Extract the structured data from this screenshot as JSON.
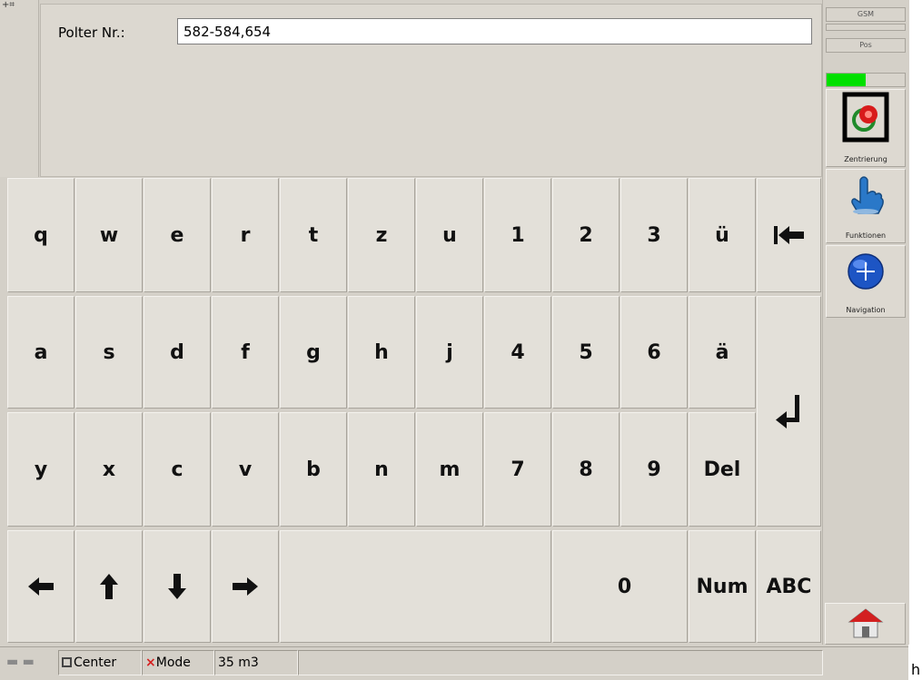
{
  "form": {
    "label": "Polter Nr.:",
    "value": "582-584,654"
  },
  "keyboard": {
    "row1": [
      "q",
      "w",
      "e",
      "r",
      "t",
      "z",
      "u",
      "1",
      "2",
      "3",
      "ü"
    ],
    "row2": [
      "a",
      "s",
      "d",
      "f",
      "g",
      "h",
      "j",
      "4",
      "5",
      "6",
      "ä"
    ],
    "row3": [
      "y",
      "x",
      "c",
      "v",
      "b",
      "n",
      "m",
      "7",
      "8",
      "9",
      "Del"
    ],
    "row4": {
      "zero": "0",
      "num": "Num",
      "abc": "ABC"
    },
    "icons": [
      "backspace-icon",
      "enter-icon",
      "arrow-left-icon",
      "arrow-up-icon",
      "arrow-down-icon",
      "arrow-right-icon"
    ]
  },
  "sidebar": {
    "gsm": "GSM",
    "pos": "Pos",
    "signal_level": 0.5,
    "signal_color": "#00e000",
    "buttons": [
      {
        "label": "Zentrierung",
        "icon": "target-icon"
      },
      {
        "label": "Funktionen",
        "icon": "hand-icon"
      },
      {
        "label": "Navigation",
        "icon": "globe-icon"
      }
    ],
    "home_icon": "home-icon"
  },
  "status": {
    "center_label": "Center",
    "mode_label": "Mode",
    "volume": "35 m3"
  },
  "stray_text": "h"
}
